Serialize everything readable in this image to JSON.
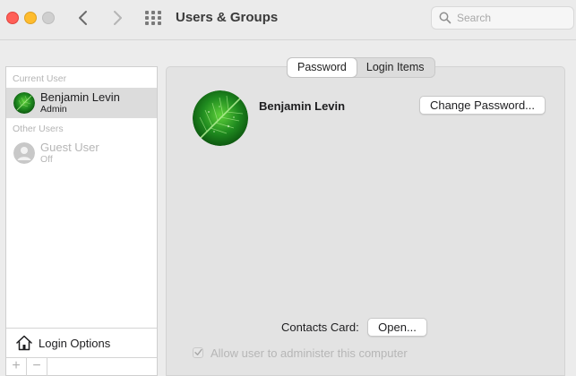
{
  "window": {
    "title": "Users & Groups",
    "search_placeholder": "Search"
  },
  "sidebar": {
    "current_user_header": "Current User",
    "other_users_header": "Other Users",
    "users": [
      {
        "name": "Benjamin Levin",
        "role": "Admin",
        "selected": true
      },
      {
        "name": "Guest User",
        "role": "Off",
        "selected": false
      }
    ],
    "login_options_label": "Login Options",
    "add_symbol": "+",
    "remove_symbol": "−"
  },
  "tabs": [
    {
      "label": "Password",
      "active": true
    },
    {
      "label": "Login Items",
      "active": false
    }
  ],
  "main": {
    "user_fullname": "Benjamin Levin",
    "change_password_label": "Change Password...",
    "contacts_card_label": "Contacts Card:",
    "open_button_label": "Open...",
    "allow_admin_label": "Allow user to administer this computer",
    "allow_admin_checked": true
  },
  "icons": {
    "back": "chevron-left-icon",
    "forward": "chevron-right-icon",
    "show_all": "grid-icon",
    "search": "magnifying-glass-icon",
    "login_options": "house-icon",
    "user_picture": "green-leaf-icon",
    "guest_picture": "person-silhouette-icon"
  },
  "colors": {
    "close": "#ff5f57",
    "minimize": "#febc2e",
    "zoom_disabled": "#cfcfcf",
    "selection": "#dcdcdc",
    "leaf": "#1f8a1f"
  }
}
